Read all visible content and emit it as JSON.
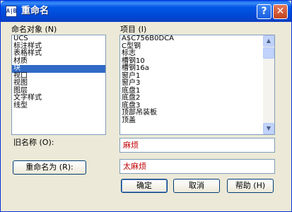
{
  "window": {
    "title": "重命名",
    "icon_text": "A|B"
  },
  "titlebar_buttons": {
    "help": "?",
    "close": "✕"
  },
  "left_panel": {
    "label": "命名对象 (N)",
    "items": [
      "UCS",
      "标注样式",
      "表格样式",
      "材质",
      "块",
      "视口",
      "视图",
      "图层",
      "文字样式",
      "线型"
    ],
    "selected_index": 4
  },
  "right_panel": {
    "label": "项目 (I)",
    "items": [
      "A$C756B0DCA",
      "C型钢",
      "标志",
      "槽钢10",
      "槽钢16a",
      "窗户1",
      "窗户3",
      "底盘1",
      "底盘2",
      "底盘3",
      "顶部吊装板",
      "顶盖"
    ]
  },
  "old_name": {
    "label": "旧名称 (O):",
    "value": "麻烦"
  },
  "rename_button": "重命名为 (R):",
  "new_name": {
    "value": "太麻烦"
  },
  "buttons": {
    "ok": "确定",
    "cancel": "取消",
    "help": "帮助 (H)"
  }
}
